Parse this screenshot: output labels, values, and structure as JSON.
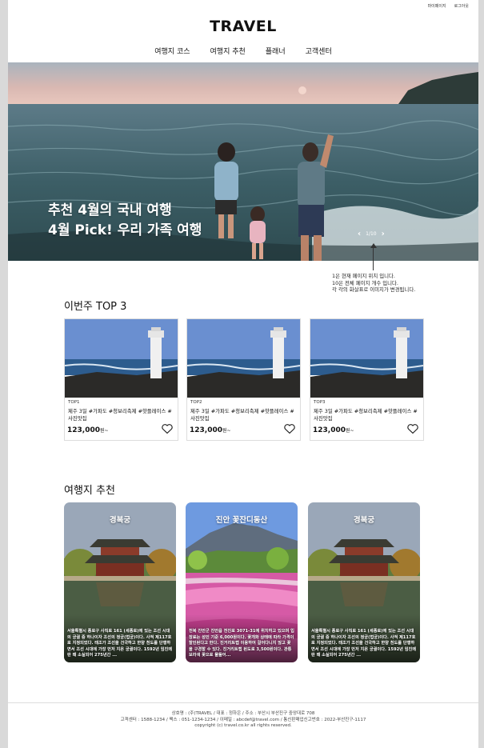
{
  "util": {
    "mypage": "마이페이지",
    "login": "로그아웃"
  },
  "logo": "TRAVEL",
  "nav": [
    "여행지 코스",
    "여행지 추천",
    "플래너",
    "고객센터"
  ],
  "hero": {
    "line1": "추천 4월의 국내 여행",
    "line2": "4월 Pick! 우리 가족 여행",
    "pager": "1/10",
    "prev_icon": "chevron-left-icon",
    "next_icon": "chevron-right-icon"
  },
  "annotation": [
    "1은 현재 페이지 위치 입니다.",
    "10은 전체 페이지 개수 입니다.",
    "각 각의 화살표로 이미지가 변경됩니다."
  ],
  "top3": {
    "title": "이번주 TOP 3",
    "items": [
      {
        "rank": "TOP1",
        "desc": "제주 3일 #가파도 #청보리축제 #핫플레이스 #사진맛집",
        "price": "123,000",
        "unit": "원~"
      },
      {
        "rank": "TOP2",
        "desc": "제주 3일 #가파도 #청보리축제 #핫플레이스 #사진맛집",
        "price": "123,000",
        "unit": "원~"
      },
      {
        "rank": "TOP3",
        "desc": "제주 3일 #가파도 #청보리축제 #핫플레이스 #사진맛집",
        "price": "123,000",
        "unit": "원~"
      }
    ]
  },
  "recommend": {
    "title": "여행지 추천",
    "items": [
      {
        "name": "경복궁",
        "desc": "서울특별시 종로구 사직로 161 (세종로)에 있는 조선 시대의 궁궐 중 하나이자 조선의 정궁(법궁)이다. 사적 제117호로 지정되었다. 태조가 조선을 건국하고 한양 천도를 단행하면서 조선 시대에 가장 먼저 지은 궁궐이다. 1592년 임진왜란 때 소실되어 275년간 ..."
      },
      {
        "name": "진안 꽃잔디동산",
        "desc": "전북 진안군 진안읍 전진로 3071-31에 위치하고 있으며 입장료는 성인 기준 6,000원이다. 꽃개화 상태에 따라 가격이 할인된다고 한다. 진거리트랩 이용하여 걸어다니지 않고 꽃을 구경할 수 있다. 진거리트랩 된도로 3,500원이다. 관통 보라색 꽃으로 물들어..."
      },
      {
        "name": "경복궁",
        "desc": "서울특별시 종로구 사직로 161 (세종로)에 있는 조선 시대의 궁궐 중 하나이자 조선의 정궁(법궁)이다. 사적 제117호로 지정되었다. 태조가 조선을 건국하고 한양 천도를 단행하면서 조선 시대에 가장 먼저 지은 궁궐이다. 1592년 임진왜란 때 소실되어 275년간 ..."
      }
    ]
  },
  "footer": [
    "상호명 : (주)TRAVEL / 대표 : 정하은 / 주소 : 부산시 부산진구 중앙대로 708",
    "고객센터 : 1588-1234 / 팩스 : 051-1234-1234 / 이메일 : abcdef@travel.com / 통신판매업신고번호 : 2022-부산진구-1117",
    "copyright (c) travel.co.kr all rights reserved."
  ]
}
